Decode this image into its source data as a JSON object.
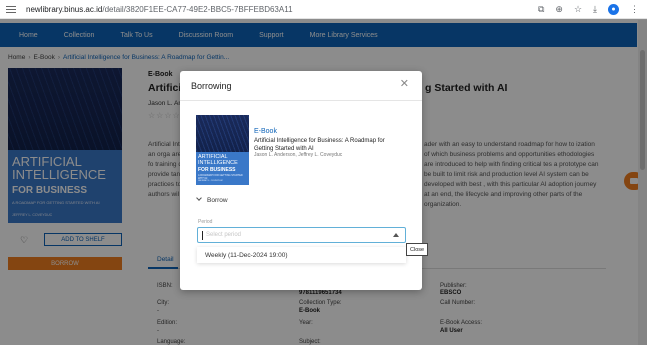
{
  "browser": {
    "url_host": "newlibrary.binus.ac.id",
    "url_path": "/detail/3820F1EE-CA77-49E2-BBC5-7BFFEBD63A11"
  },
  "nav": {
    "items": [
      "Home",
      "Collection",
      "Talk To Us",
      "Discussion Room",
      "Support",
      "More Library Services"
    ]
  },
  "breadcrumb": {
    "items": [
      "Home",
      "E-Book"
    ],
    "current": "Artificial Intelligence for Business: A Roadmap for Gettin..."
  },
  "book": {
    "type": "E-Book",
    "title_visible": "Artificial I",
    "title_tail": "g Started with AI",
    "author": "Jason L. An",
    "stars": "☆☆☆☆☆",
    "cover": {
      "line1": "ARTIFICIAL",
      "line2": "INTELLIGENCE",
      "line3": "FOR BUSINESS",
      "subtitle": "A ROADMAP FOR GETTING STARTED WITH AI",
      "author": "JEFFREY L. COVEYDUC"
    },
    "desc_left": "Artificial Int take an orga are right fo training da provide tan practices to authors wil",
    "desc_right": "ader with an easy to understand roadmap for how to ization of which business problems and opportunities ethodologies are introduced to help with finding critical tes a prototype can be built to limit risk and production level AI system can be developed with best , with this particular AI adoption journey at an end, the lifecycle and improving other parts of the organization."
  },
  "actions": {
    "add_to_shelf": "ADD TO SHELF",
    "borrow": "BORROW"
  },
  "tabs": {
    "detail": "Detail"
  },
  "metadata": {
    "isbn_label": "ISBN:",
    "isbn_value": "9781119651734",
    "publisher_label": "Publisher:",
    "publisher_value": "EBSCO",
    "city_label": "City:",
    "city_value": "-",
    "collection_type_label": "Collection Type:",
    "collection_type_value": "E-Book",
    "call_number_label": "Call Number:",
    "edition_label": "Edition:",
    "edition_value": "-",
    "year_label": "Year:",
    "ebook_access_label": "E-Book Access:",
    "ebook_access_value": "All User",
    "language_label": "Language:",
    "subject_label": "Subject:"
  },
  "modal": {
    "title": "Borrowing",
    "close_tooltip": "Close",
    "item_type": "E-Book",
    "item_title": "Artificial Intelligence for Business: A Roadmap for Getting Started with AI",
    "item_author": "Jason L. Anderson, Jeffrey L. Coveyduc",
    "section_label": "Borrow",
    "period_label": "Period",
    "period_placeholder": "Select period",
    "period_option": "Weekly (11-Dec-2024 19:00)",
    "cover": {
      "line1": "ARTIFICIAL",
      "line2": "INTELLIGENCE",
      "line3": "FOR BUSINESS",
      "subtitle": "A ROADMAP FOR GETTING STARTED WITH AI",
      "author": "JEFFREY L. COVEYDUC"
    }
  },
  "colors": {
    "nav": "#0d63b8",
    "accent_orange": "#f07f20",
    "link_blue": "#0d63b8"
  }
}
